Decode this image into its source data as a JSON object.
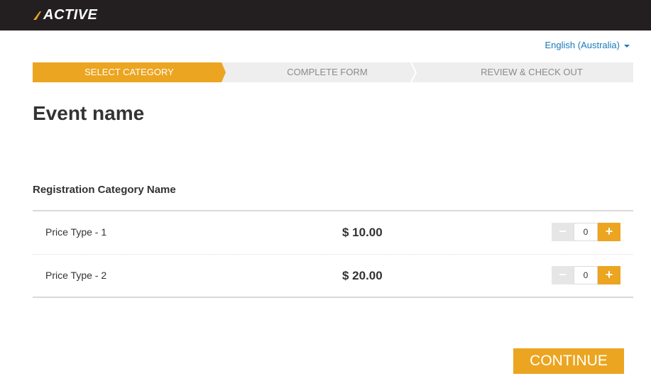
{
  "brand": {
    "logo_text": "ACTIVE",
    "accent_color": "#eba520",
    "topbar_color": "#231f20"
  },
  "language": {
    "selected": "English (Australia)"
  },
  "steps": [
    {
      "label": "SELECT CATEGORY",
      "active": true
    },
    {
      "label": "COMPLETE FORM",
      "active": false
    },
    {
      "label": "REVIEW & CHECK OUT",
      "active": false
    }
  ],
  "event": {
    "title": "Event name"
  },
  "registration": {
    "category_name": "Registration Category Name",
    "rows": [
      {
        "name": "Price Type - 1",
        "price": "$ 10.00",
        "quantity": "0"
      },
      {
        "name": "Price Type - 2",
        "price": "$ 20.00",
        "quantity": "0"
      }
    ],
    "minus_symbol": "−",
    "plus_symbol": "+"
  },
  "actions": {
    "continue_label": "CONTINUE"
  }
}
